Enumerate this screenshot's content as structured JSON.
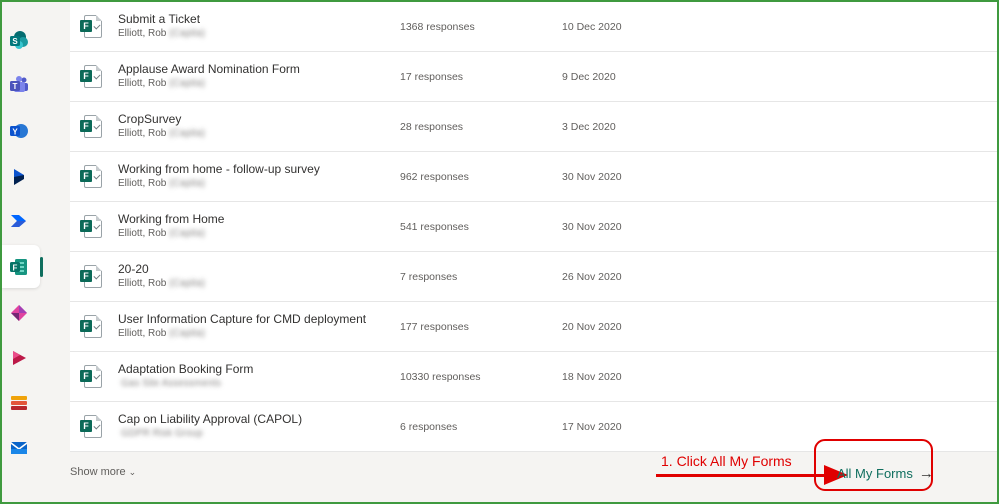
{
  "rail": {
    "icons": [
      "sharepoint-icon",
      "teams-icon",
      "yammer-icon",
      "dynamics-icon",
      "power-automate-icon",
      "forms-icon",
      "power-apps-icon",
      "stream-icon",
      "office-apps-icon",
      "outlook-icon"
    ],
    "active": "forms-icon",
    "accent": "#0f6e5e"
  },
  "forms": [
    {
      "title": "Submit a Ticket",
      "owner": "Elliott, Rob",
      "owner_redacted": "(Capita)",
      "responses": "1368 responses",
      "date": "10 Dec 2020"
    },
    {
      "title": "Applause Award Nomination Form",
      "owner": "Elliott, Rob",
      "owner_redacted": "(Capita)",
      "responses": "17 responses",
      "date": "9 Dec 2020"
    },
    {
      "title": "CropSurvey",
      "owner": "Elliott, Rob",
      "owner_redacted": "(Capita)",
      "responses": "28 responses",
      "date": "3 Dec 2020"
    },
    {
      "title": "Working from home - follow-up survey",
      "owner": "Elliott, Rob",
      "owner_redacted": "(Capita)",
      "responses": "962 responses",
      "date": "30 Nov 2020"
    },
    {
      "title": "Working from Home",
      "owner": "Elliott, Rob",
      "owner_redacted": "(Capita)",
      "responses": "541 responses",
      "date": "30 Nov 2020"
    },
    {
      "title": "20-20",
      "owner": "Elliott, Rob",
      "owner_redacted": "(Capita)",
      "responses": "7 responses",
      "date": "26 Nov 2020"
    },
    {
      "title": "User Information Capture for CMD deployment",
      "owner": "Elliott, Rob",
      "owner_redacted": "(Capita)",
      "responses": "177 responses",
      "date": "20 Nov 2020"
    },
    {
      "title": "Adaptation Booking Form",
      "owner": "",
      "owner_redacted": "Gas Site Assessments",
      "responses": "10330 responses",
      "date": "18 Nov 2020"
    },
    {
      "title": "Cap on Liability Approval (CAPOL)",
      "owner": "",
      "owner_redacted": "GDPR Risk Group",
      "responses": "6 responses",
      "date": "17 Nov 2020"
    }
  ],
  "footer": {
    "show_more": "Show more",
    "all_my_forms": "All My Forms"
  },
  "annotation": {
    "text": "1.  Click All My Forms",
    "color": "#e00000"
  }
}
